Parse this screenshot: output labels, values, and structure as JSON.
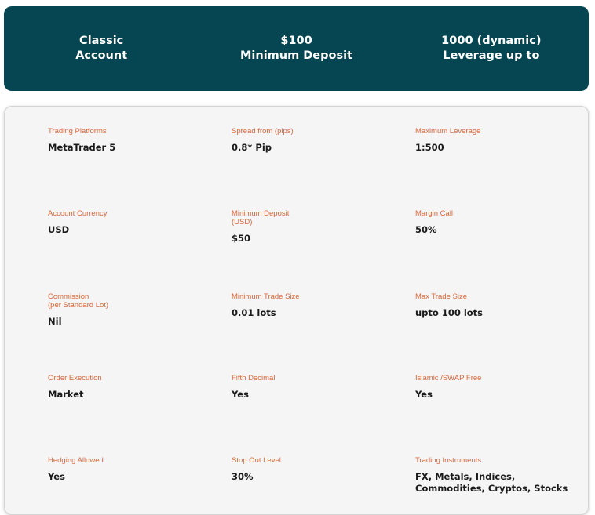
{
  "header": {
    "columns": [
      {
        "line1": "Classic",
        "line2": "Account"
      },
      {
        "line1": "$100",
        "line2": "Minimum Deposit"
      },
      {
        "line1": "1000 (dynamic)",
        "line2": "Leverage up to"
      }
    ]
  },
  "colors": {
    "header_bg": "#054652",
    "label": "#d9663a"
  },
  "specs": [
    {
      "label": "Trading Platforms",
      "value": "MetaTrader 5"
    },
    {
      "label": "Spread from (pips)",
      "value": "0.8* Pip"
    },
    {
      "label": "Maximum Leverage",
      "value": "1:500"
    },
    {
      "label": "Account Currency",
      "value": "USD"
    },
    {
      "label": "Minimum Deposit\n(USD)",
      "value": "$50"
    },
    {
      "label": "Margin Call",
      "value": "50%"
    },
    {
      "label": "Commission\n(per Standard Lot)",
      "value": "Nil"
    },
    {
      "label": "Minimum Trade Size",
      "value": "0.01 lots"
    },
    {
      "label": "Max Trade Size",
      "value": "upto 100 lots"
    },
    {
      "label": "Order Execution",
      "value": "Market"
    },
    {
      "label": "Fifth Decimal",
      "value": "Yes"
    },
    {
      "label": "Islamic /SWAP Free",
      "value": "Yes"
    },
    {
      "label": "Hedging Allowed",
      "value": "Yes"
    },
    {
      "label": "Stop Out Level",
      "value": "30%"
    },
    {
      "label": "Trading Instruments:",
      "value": "FX, Metals, Indices,\nCommodities, Cryptos, Stocks"
    }
  ]
}
